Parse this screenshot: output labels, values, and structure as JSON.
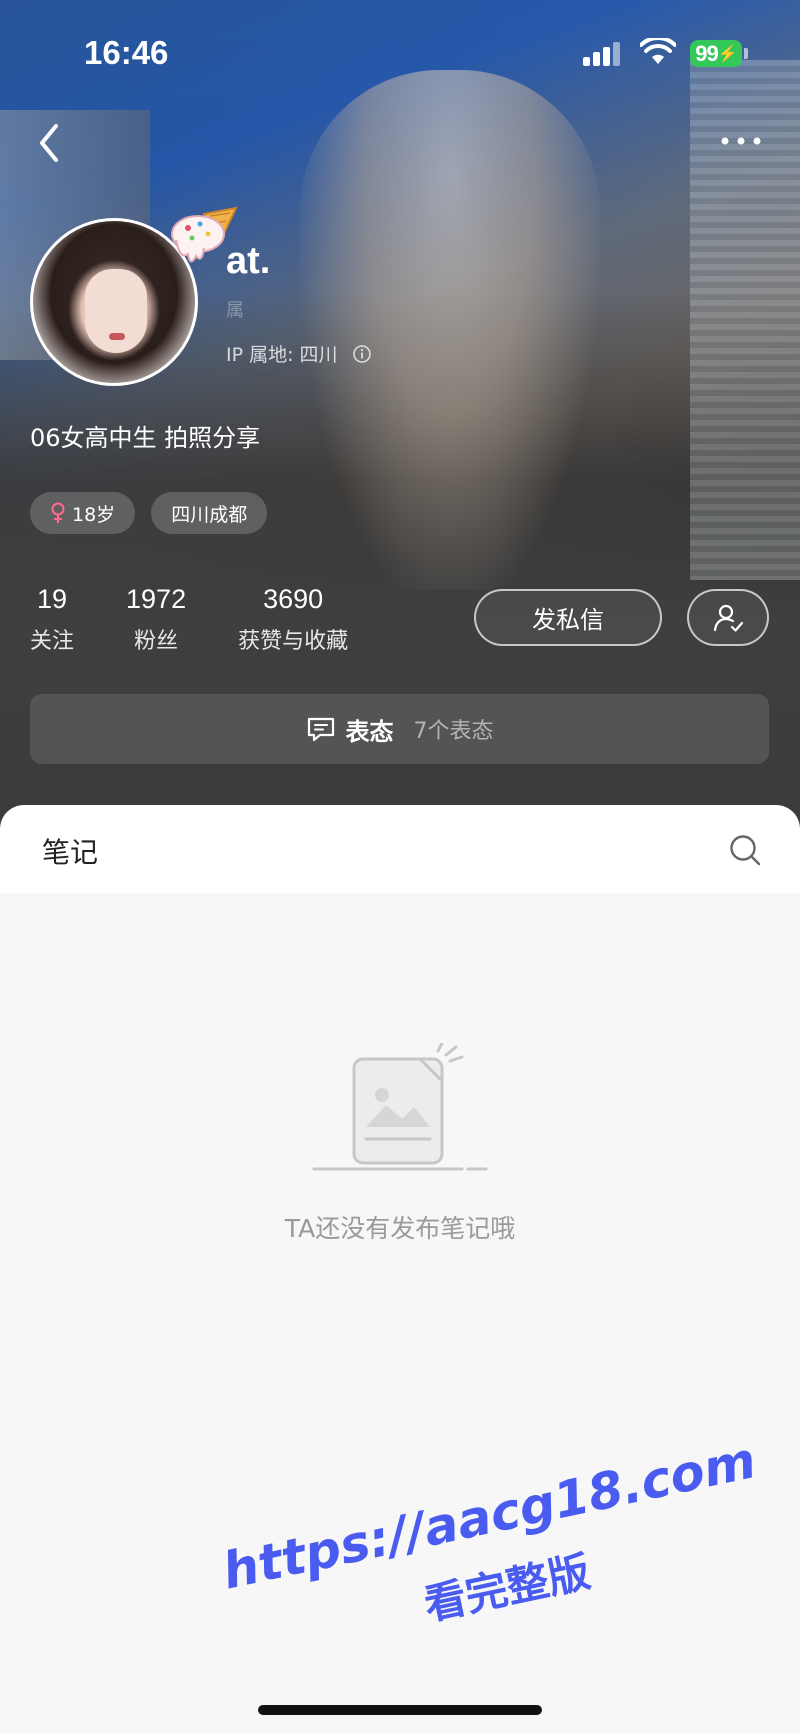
{
  "status_bar": {
    "time": "16:46",
    "battery": "99"
  },
  "profile": {
    "username": "at.",
    "user_id_faded": "属",
    "ip_location": "IP 属地: 四川",
    "bio": "06女高中生 拍照分享",
    "tags": {
      "age": "18岁",
      "location": "四川成都"
    }
  },
  "stats": [
    {
      "value": "19",
      "label": "关注"
    },
    {
      "value": "1972",
      "label": "粉丝"
    },
    {
      "value": "3690",
      "label": "获赞与收藏"
    }
  ],
  "actions": {
    "message_label": "发私信"
  },
  "moods": {
    "title": "表态",
    "count": "7个表态"
  },
  "notes": {
    "tab_label": "笔记",
    "empty_text": "TA还没有发布笔记哦"
  },
  "watermark": {
    "url": "https://aacg18.com",
    "sub": "看完整版"
  },
  "colors": {
    "battery_green": "#34c759",
    "watermark_blue": "#4a5cf0",
    "female_pink": "#ff6b8a"
  }
}
